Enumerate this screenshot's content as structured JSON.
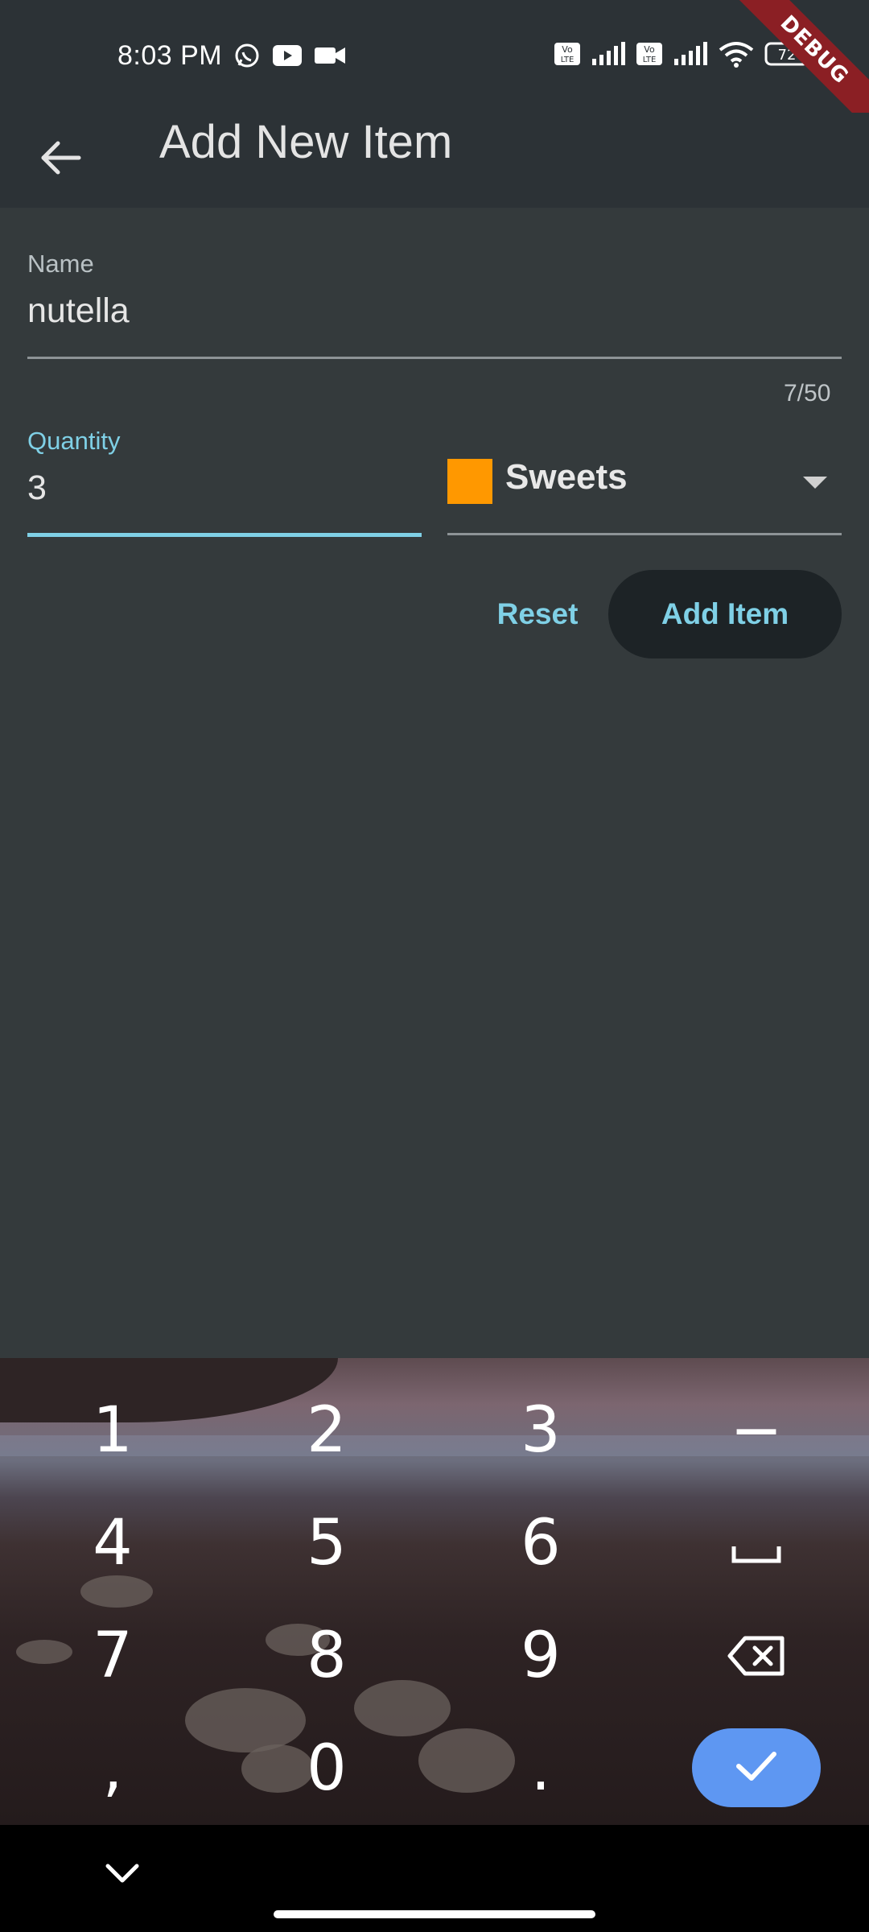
{
  "status_bar": {
    "time": "8:03 PM",
    "left_icons": [
      "whatsapp-icon",
      "youtube-icon",
      "video-camera-icon"
    ],
    "right_icons": [
      "volte-icon",
      "signal-icon",
      "volte-icon",
      "signal-icon",
      "wifi-icon",
      "battery-icon"
    ],
    "volte_label": "Vo LTE",
    "battery_level": "72",
    "debug_banner": "DEBUG"
  },
  "app_bar": {
    "title": "Add New Item",
    "back_icon": "arrow-back-icon"
  },
  "form": {
    "name": {
      "label": "Name",
      "value": "nutella",
      "counter": "7/50"
    },
    "quantity": {
      "label": "Quantity",
      "value": "3"
    },
    "category": {
      "selected": "Sweets",
      "swatch_color": "#ff9800"
    },
    "reset_label": "Reset",
    "add_label": "Add Item"
  },
  "colors": {
    "accent": "#7fd0e6",
    "background": "#343a3c",
    "app_bar": "#2c3236",
    "keyboard_done": "#5e97f2"
  },
  "keyboard": {
    "keys": [
      "1",
      "2",
      "3",
      "−",
      "4",
      "5",
      "6",
      "␣",
      "7",
      "8",
      "9",
      "backspace",
      ",",
      "0",
      ".",
      "done"
    ]
  },
  "nav_bar": {
    "collapse_icon": "chevron-down-icon"
  }
}
